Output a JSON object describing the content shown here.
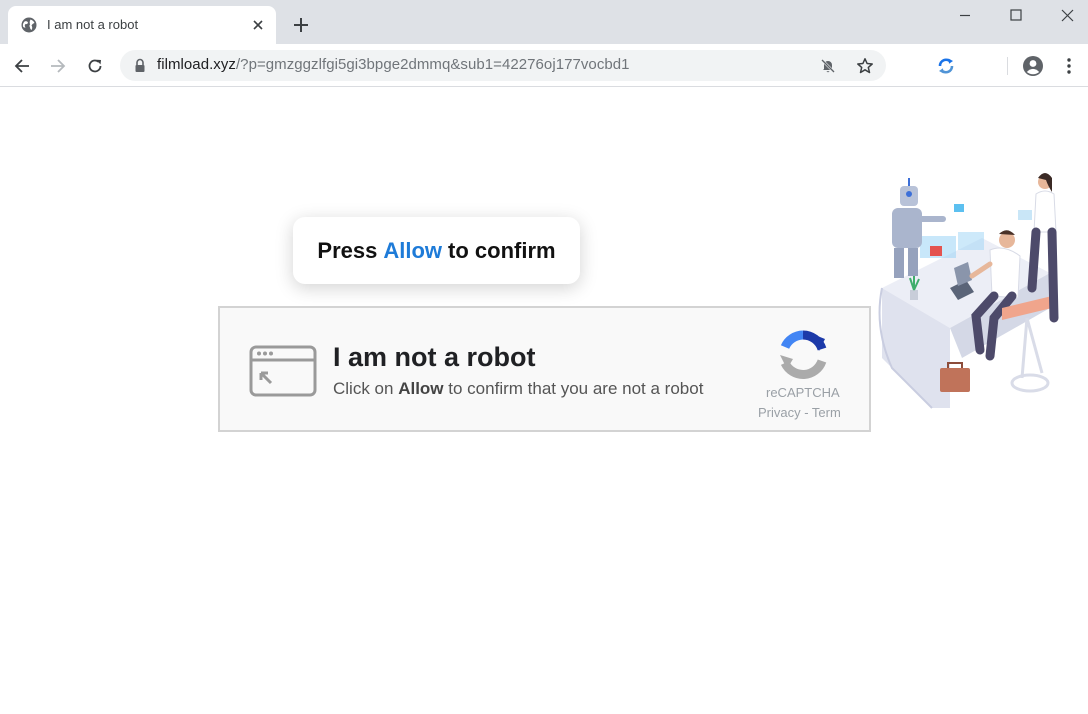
{
  "tab": {
    "title": "I am not a robot",
    "favicon": "globe-icon"
  },
  "window_controls": [
    "minimize-icon",
    "maximize-icon",
    "close-icon"
  ],
  "address_bar": {
    "host": "filmload.xyz",
    "path": "/?p=gmzggzlfgi5gi3bpge2dmmq&sub1=42276oj177vocbd1"
  },
  "toolbar_icons": [
    "back-icon",
    "forward-icon",
    "reload-icon",
    "lock-icon",
    "notifications-blocked-icon",
    "star-icon",
    "extension-sync-icon",
    "profile-icon",
    "menu-icon"
  ],
  "tooltip": {
    "prefix": "Press",
    "accent": "Allow",
    "suffix": "to confirm"
  },
  "captcha": {
    "title": "I am not a robot",
    "subtitle_prefix": "Click on",
    "subtitle_bold": "Allow",
    "subtitle_suffix": "to confirm that you are not a robot",
    "brand": "reCAPTCHA",
    "links": "Privacy - Term"
  },
  "colors": {
    "accent": "#1e7bd8",
    "tabstrip": "#dee1e6",
    "omnibox": "#f1f3f4"
  }
}
